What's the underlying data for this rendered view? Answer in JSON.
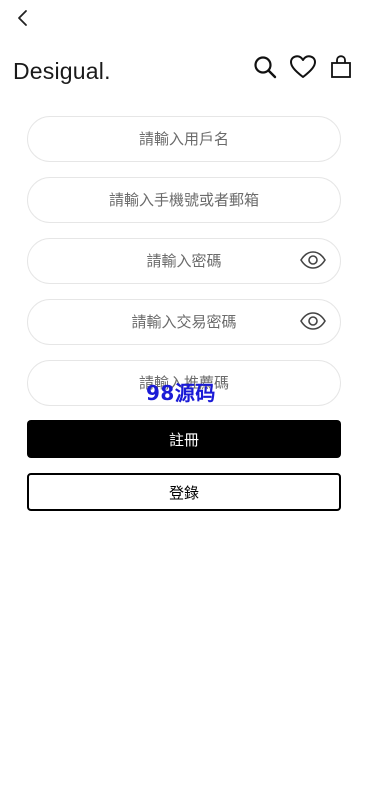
{
  "top_bar": {
    "back_icon": "chevron-left-icon"
  },
  "header": {
    "logo": "Desigual.",
    "icons": [
      "search-icon",
      "heart-icon",
      "shopping-bag-icon"
    ]
  },
  "form": {
    "username": {
      "placeholder": "請輸入用戶名",
      "value": ""
    },
    "phone_email": {
      "placeholder": "請輸入手機號或者郵箱",
      "value": ""
    },
    "password": {
      "placeholder": "請輸入密碼",
      "value": "",
      "icon": "eye-icon"
    },
    "trade_password": {
      "placeholder": "請輸入交易密碼",
      "value": "",
      "icon": "eye-icon"
    },
    "referral_code": {
      "placeholder": "請輸入推薦碼",
      "value": ""
    }
  },
  "watermark": {
    "text": "98源码",
    "color": "#1a1ad6"
  },
  "actions": {
    "register_label": "註冊",
    "login_label": "登錄"
  },
  "colors": {
    "primary_button_bg": "#000000",
    "primary_button_text": "#ffffff",
    "field_border": "#e6e6e6",
    "placeholder": "#6b6b6b"
  }
}
